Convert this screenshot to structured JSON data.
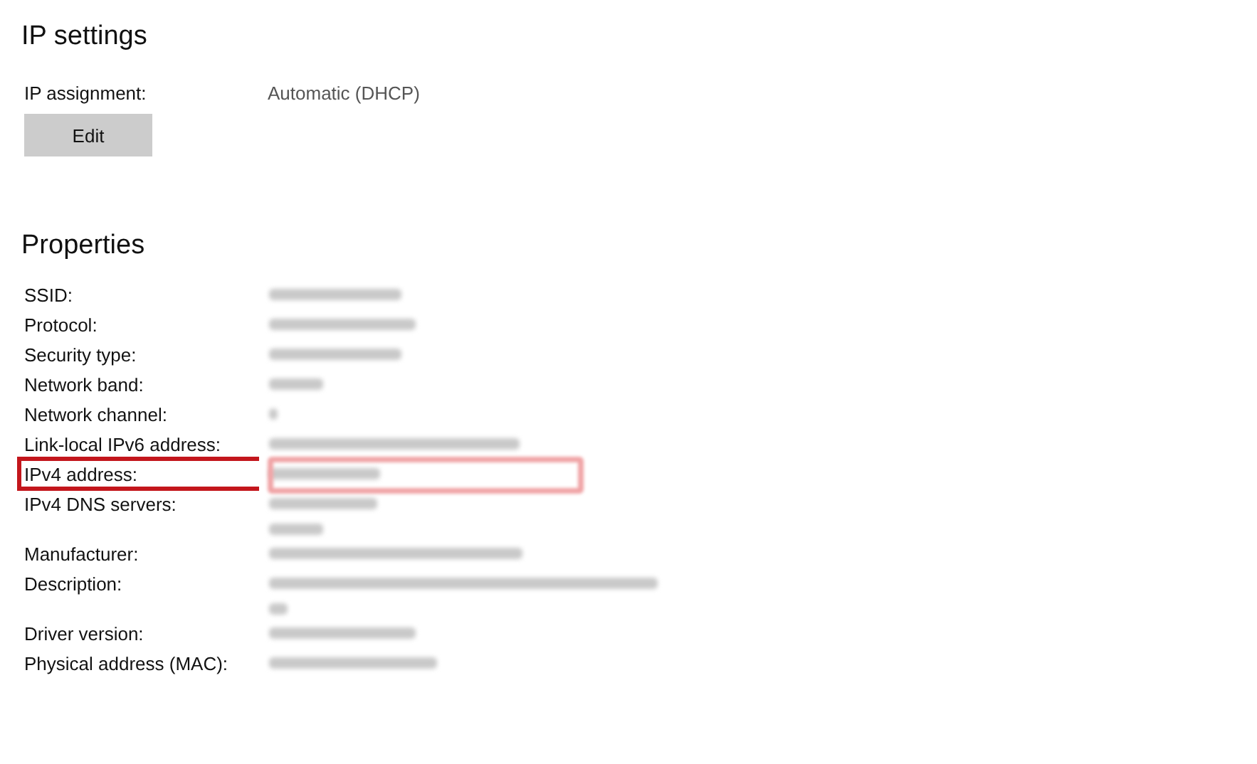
{
  "ip_settings": {
    "title": "IP settings",
    "assignment_label": "IP assignment:",
    "assignment_value": "Automatic (DHCP)",
    "edit_button": "Edit"
  },
  "properties": {
    "title": "Properties",
    "rows": [
      {
        "label": "SSID:",
        "value_lines": [
          {
            "kind": "blurred"
          }
        ],
        "highlighted": false
      },
      {
        "label": "Protocol:",
        "value_lines": [
          {
            "kind": "blurred"
          }
        ],
        "highlighted": false
      },
      {
        "label": "Security type:",
        "value_lines": [
          {
            "kind": "blurred"
          }
        ],
        "highlighted": false
      },
      {
        "label": "Network band:",
        "value_lines": [
          {
            "kind": "blurred"
          }
        ],
        "highlighted": false
      },
      {
        "label": "Network channel:",
        "value_lines": [
          {
            "kind": "blurred"
          }
        ],
        "highlighted": false
      },
      {
        "label": "Link-local IPv6 address:",
        "value_lines": [
          {
            "kind": "blurred"
          }
        ],
        "highlighted": false
      },
      {
        "label": "IPv4 address:",
        "value_lines": [
          {
            "kind": "blurred"
          }
        ],
        "highlighted": true
      },
      {
        "label": "IPv4 DNS servers:",
        "value_lines": [
          {
            "kind": "blurred"
          },
          {
            "kind": "blurred"
          }
        ],
        "highlighted": false
      },
      {
        "label": "Manufacturer:",
        "value_lines": [
          {
            "kind": "blurred"
          }
        ],
        "highlighted": false
      },
      {
        "label": "Description:",
        "value_lines": [
          {
            "kind": "blurred"
          },
          {
            "kind": "blurred"
          }
        ],
        "highlighted": false
      },
      {
        "label": "Driver version:",
        "value_lines": [
          {
            "kind": "blurred"
          }
        ],
        "highlighted": false
      },
      {
        "label": "Physical address (MAC):",
        "value_lines": [
          {
            "kind": "blurred"
          }
        ],
        "highlighted": false
      }
    ]
  }
}
